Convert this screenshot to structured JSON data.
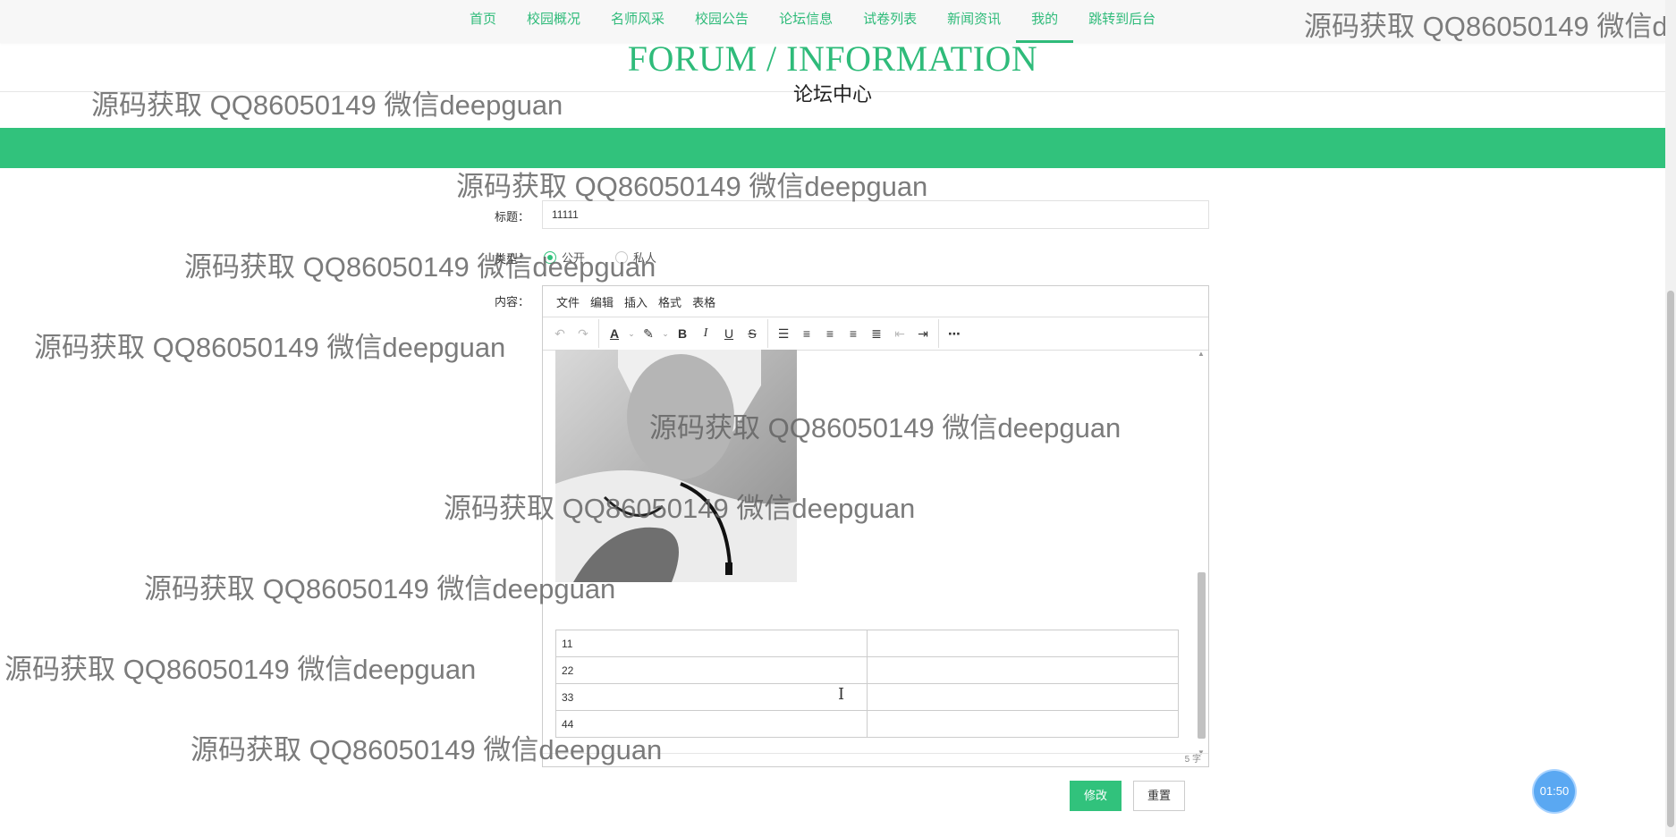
{
  "nav": {
    "links": [
      "首页",
      "校园概况",
      "名师风采",
      "校园公告",
      "论坛信息",
      "试卷列表",
      "新闻资讯",
      "我的",
      "跳转到后台"
    ],
    "active_index": 7
  },
  "header": {
    "title_en": "FORUM / INFORMATION",
    "title_cn": "论坛中心"
  },
  "form": {
    "title_label": "标题：",
    "title_value": "11111",
    "type_label": "类型：",
    "type_options": [
      "公开",
      "私人"
    ],
    "type_selected": "公开",
    "content_label": "内容："
  },
  "editor": {
    "menu": [
      "文件",
      "编辑",
      "插入",
      "格式",
      "表格"
    ],
    "toolbar_icons": [
      "undo-icon",
      "redo-icon",
      "font-color-icon",
      "highlight-icon",
      "bold-icon",
      "italic-icon",
      "underline-icon",
      "strikethrough-icon",
      "numbered-list-icon",
      "align-left-icon",
      "align-center-icon",
      "align-right-icon",
      "justify-icon",
      "outdent-icon",
      "indent-icon",
      "more-icon"
    ],
    "table_rows": [
      "11",
      "22",
      "33",
      "44"
    ],
    "word_count": "5 字"
  },
  "buttons": {
    "save": "修改",
    "reset": "重置"
  },
  "timer": "01:50",
  "watermark": "源码获取 QQ86050149 微信deepguan",
  "watermark_clipped": "源码获取 QQ86050149 微信de",
  "colors": {
    "accent": "#31c27c",
    "nav_text": "#2fbb7a"
  }
}
